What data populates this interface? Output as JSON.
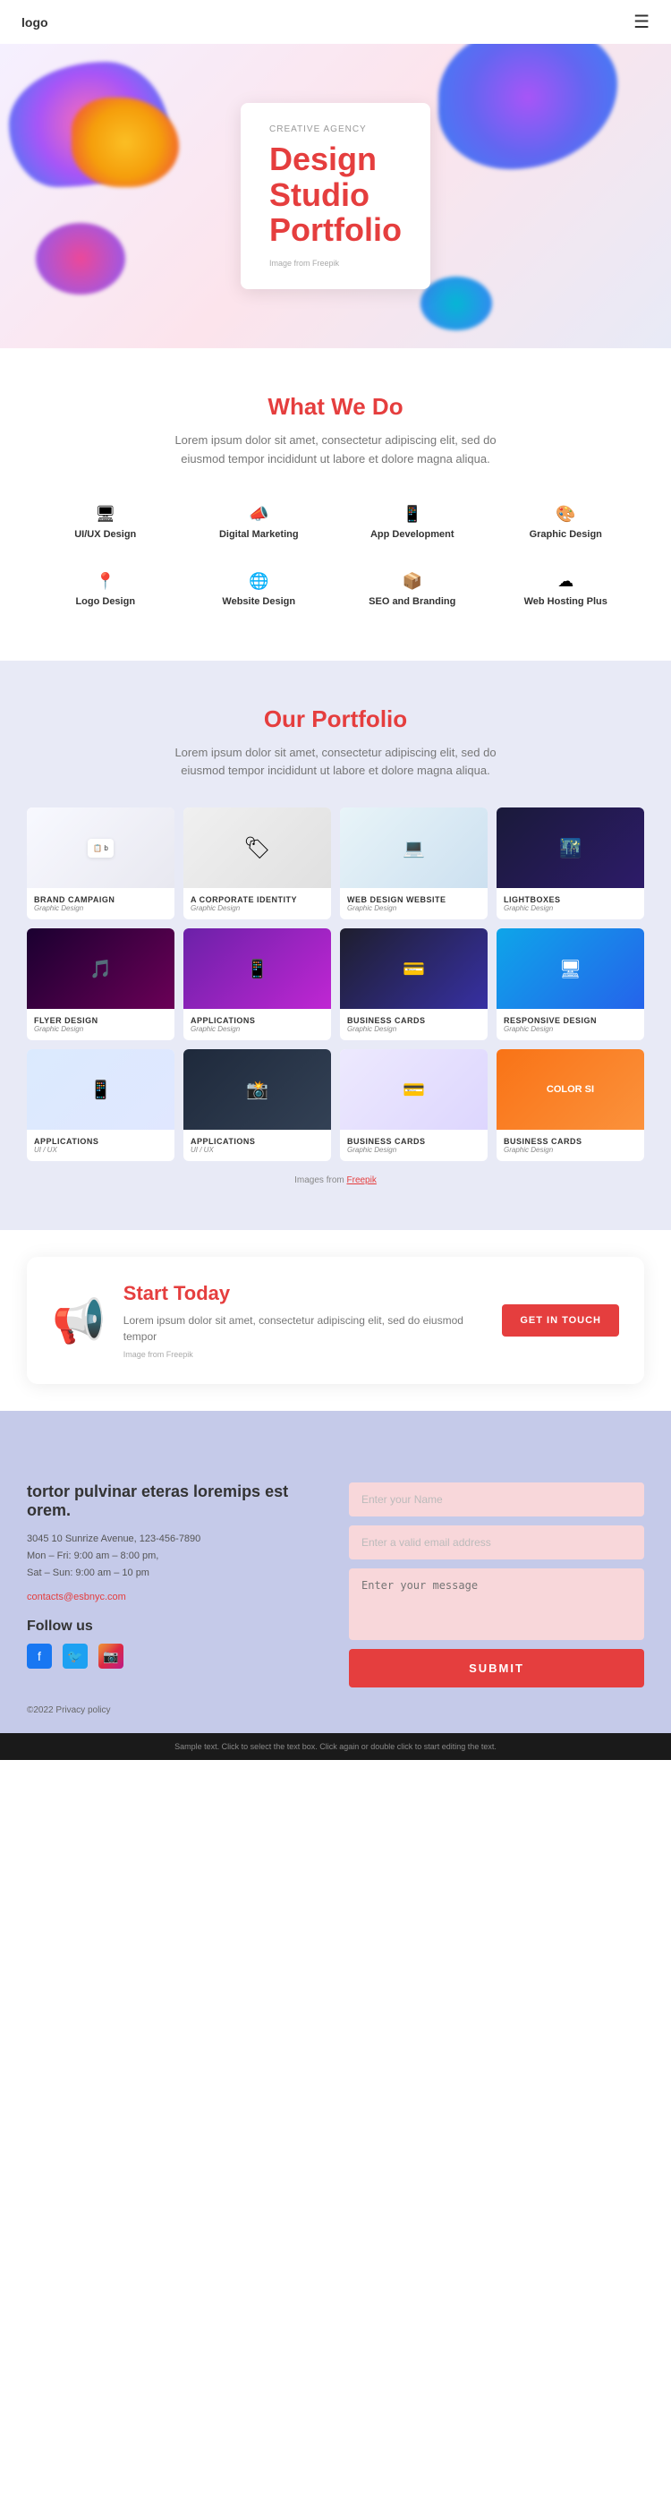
{
  "header": {
    "logo": "logo",
    "menu_icon": "☰"
  },
  "hero": {
    "subtitle": "CREATIVE AGENCY",
    "title_line1": "Design",
    "title_line2": "Studio",
    "title_line3": "Portfolio",
    "image_credit": "Image from Freepik"
  },
  "what_we_do": {
    "title": "What We Do",
    "description": "Lorem ipsum dolor sit amet, consectetur adipiscing elit, sed do eiusmod tempor incididunt ut labore et dolore magna aliqua.",
    "services": [
      {
        "id": "uiux",
        "icon": "🖥",
        "label": "UI/UX Design"
      },
      {
        "id": "digital",
        "icon": "📣",
        "label": "Digital Marketing"
      },
      {
        "id": "app",
        "icon": "📱",
        "label": "App Development"
      },
      {
        "id": "graphic",
        "icon": "🎨",
        "label": "Graphic Design"
      },
      {
        "id": "logo",
        "icon": "📍",
        "label": "Logo Design"
      },
      {
        "id": "website",
        "icon": "🌐",
        "label": "Website Design"
      },
      {
        "id": "seo",
        "icon": "📦",
        "label": "SEO and Branding"
      },
      {
        "id": "hosting",
        "icon": "☁",
        "label": "Web Hosting Plus"
      }
    ]
  },
  "portfolio": {
    "title": "Our Portfolio",
    "description": "Lorem ipsum dolor sit amet, consectetur adipiscing elit, sed do eiusmod tempor incididunt ut labore et dolore magna aliqua.",
    "items": [
      {
        "id": "brand",
        "name": "BRAND CAMPAIGN",
        "category": "Graphic Design",
        "bg": "brand"
      },
      {
        "id": "corporate",
        "name": "A CORPORATE IDENTITY",
        "category": "Graphic Design",
        "bg": "corporate"
      },
      {
        "id": "web",
        "name": "WEB DESIGN WEBSITE",
        "category": "Graphic Design",
        "bg": "web"
      },
      {
        "id": "lightbox",
        "name": "LIGHTBOXES",
        "category": "Graphic Design",
        "bg": "lightbox"
      },
      {
        "id": "flyer",
        "name": "FLYER DESIGN",
        "category": "Graphic Design",
        "bg": "flyer"
      },
      {
        "id": "apps1",
        "name": "APPLICATIONS",
        "category": "Graphic Design",
        "bg": "apps"
      },
      {
        "id": "bizcard1",
        "name": "BUSINESS CARDS",
        "category": "Graphic Design",
        "bg": "bizcard"
      },
      {
        "id": "responsive",
        "name": "RESPONSIVE DESIGN",
        "category": "Graphic Design",
        "bg": "responsive"
      },
      {
        "id": "apps2",
        "name": "APPLICATIONS",
        "category": "UI / UX",
        "bg": "apps2"
      },
      {
        "id": "apps3",
        "name": "APPLICATIONS",
        "category": "UI / UX",
        "bg": "apps3"
      },
      {
        "id": "bizcard2",
        "name": "BUSINESS CARDS",
        "category": "Graphic Design",
        "bg": "bizcard2"
      },
      {
        "id": "bizcard3",
        "name": "BUSINESS CARDS",
        "category": "Graphic Design",
        "bg": "bizcard3"
      }
    ],
    "credits": "Images from Freepik"
  },
  "start_today": {
    "title": "Start Today",
    "description": "Lorem ipsum dolor sit amet, consectetur adipiscing elit, sed do eiusmod tempor",
    "image_credit": "Image from Freepik",
    "button": "GET IN TOUCH"
  },
  "footer": {
    "tagline": "tortor pulvinar eteras loremips est orem.",
    "address": "3045 10 Sunrize Avenue, 123-456-7890\nMon – Fri: 9:00 am – 8:00 pm,\nSat – Sun: 9:00 am – 10 pm",
    "email": "contacts@esbnyc.com",
    "follow_label": "Follow us",
    "socials": [
      "facebook",
      "twitter",
      "instagram"
    ],
    "form": {
      "name_placeholder": "Enter your Name",
      "email_placeholder": "Enter a valid email address",
      "message_placeholder": "Enter your message",
      "submit_label": "SUBMIT"
    },
    "copyright": "©2022 Privacy policy"
  },
  "bottom_bar": {
    "text": "Sample text. Click to select the text box. Click again or double click to start editing the text."
  }
}
